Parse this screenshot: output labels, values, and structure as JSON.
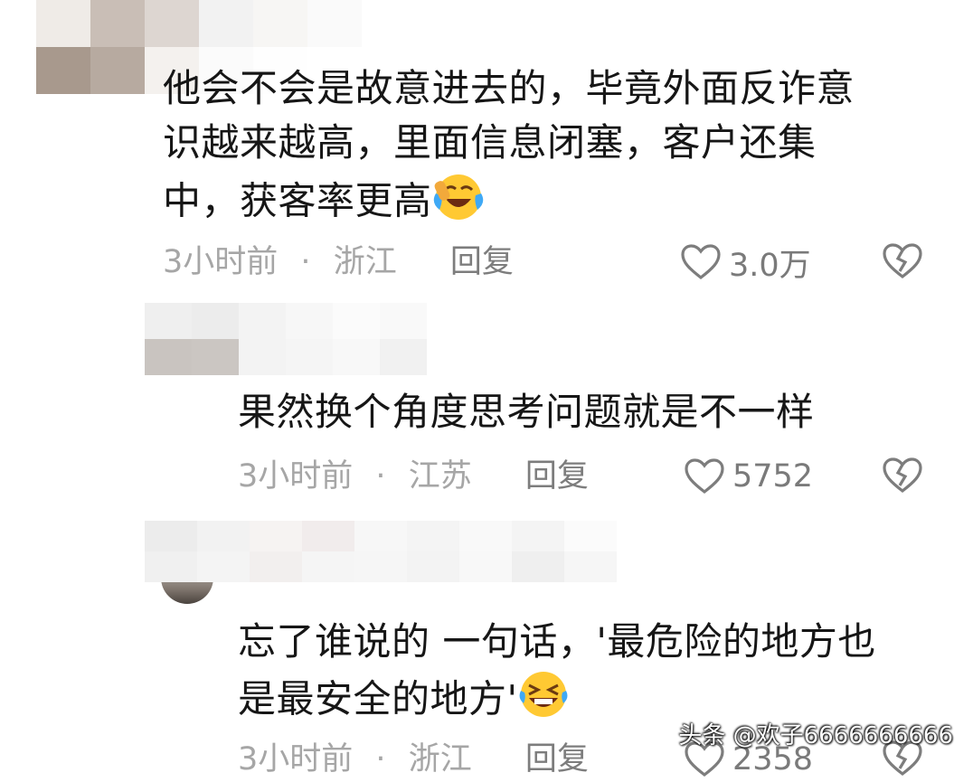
{
  "comments": [
    {
      "lines": [
        "他会不会是故意进去的，毕竟外面反诈意",
        "识越来越高，里面信息闭塞，客户还集",
        "中，获客率更高"
      ],
      "emoji": "laughing-crying-emoji",
      "time": "3小时前",
      "dot": "·",
      "location": "浙江",
      "reply": "回复",
      "likes": "3.0万"
    },
    {
      "lines": [
        "果然换个角度思考问题就是不一样"
      ],
      "time": "3小时前",
      "dot": "·",
      "location": "江苏",
      "reply": "回复",
      "likes": "5752"
    },
    {
      "lines": [
        "忘了谁说的 一句话，'最危险的地方也",
        "是最安全的地方'"
      ],
      "emoji": "big-laugh-emoji",
      "time": "3小时前",
      "dot": "·",
      "location": "浙江",
      "reply": "回复",
      "likes": "2358"
    }
  ],
  "icons": {
    "like": "heart-outline-icon",
    "dislike": "broken-heart-icon"
  },
  "watermark": "头条 @欢子6666666666",
  "colors": {
    "meta": "#a6a6a6",
    "reply": "#7d7d7d",
    "text": "#161616"
  }
}
